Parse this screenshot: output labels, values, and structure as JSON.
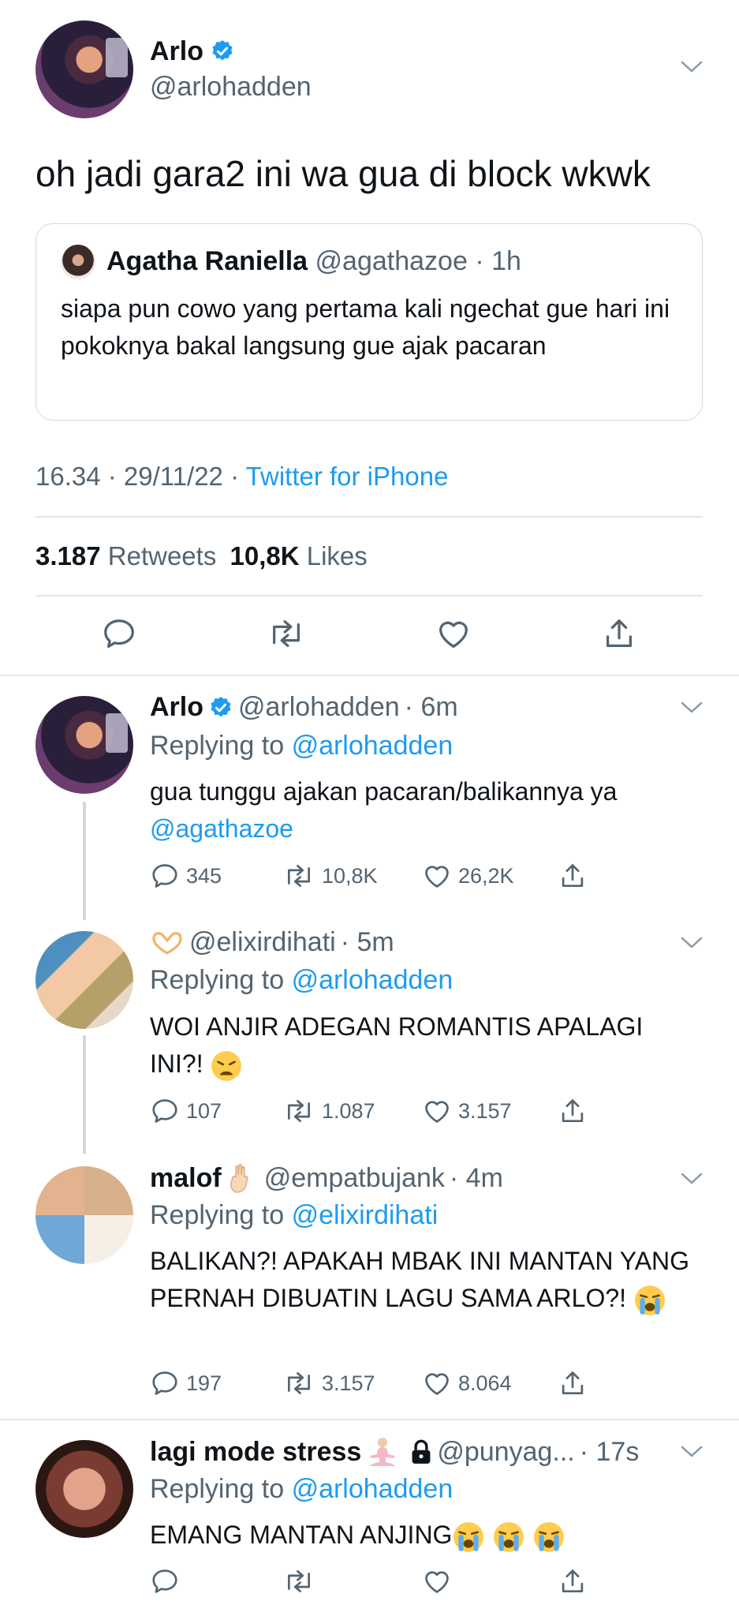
{
  "colors": {
    "accent": "#1d9bf0",
    "text": "#0f1419",
    "secondary": "#536471",
    "divider": "#e1e8ed"
  },
  "main_tweet": {
    "name": "Arlo",
    "handle": "@arlohadden",
    "text": "oh jadi gara2 ini wa gua di block wkwk",
    "quote": {
      "name": "Agatha Raniella",
      "handle": "@agathazoe",
      "time": "· 1h",
      "text": "siapa pun cowo yang pertama kali ngechat gue hari ini pokoknya bakal langsung gue ajak pacaran"
    },
    "time": "16.34 · 29/11/22 · ",
    "source": "Twitter for iPhone",
    "retweets_count": "3.187",
    "retweets_label": "Retweets",
    "likes_count": "10,8K",
    "likes_label": "Likes"
  },
  "replies": [
    {
      "name": "Arlo",
      "handle": "@arlohadden",
      "time": "· 6m",
      "replying_label": "Replying to",
      "replying_to": "@arlohadden",
      "text": "gua tunggu ajakan pacaran/balikannya ya",
      "mention": "@agathazoe",
      "replies": "345",
      "retweets": "10,8K",
      "likes": "26,2K"
    },
    {
      "name": "",
      "handle": "@elixirdihati",
      "time": "· 5m",
      "replying_label": "Replying to",
      "replying_to": "@arlohadden",
      "text": "WOI ANJIR ADEGAN ROMANTIS APALAGI INI?!",
      "replies": "107",
      "retweets": "1.087",
      "likes": "3.157"
    },
    {
      "name": "malof",
      "handle": "@empatbujank",
      "time": "· 4m",
      "replying_label": "Replying to",
      "replying_to": "@elixirdihati",
      "text": "BALIKAN?! APAKAH MBAK INI MANTAN YANG PERNAH DIBUATIN LAGU SAMA ARLO?!",
      "replies": "197",
      "retweets": "3.157",
      "likes": "8.064"
    },
    {
      "name": "lagi mode stress",
      "handle": "@punyag...",
      "time": "· 17s",
      "replying_label": "Replying to",
      "replying_to": "@arlohadden",
      "text": "EMANG MANTAN ANJING"
    }
  ]
}
